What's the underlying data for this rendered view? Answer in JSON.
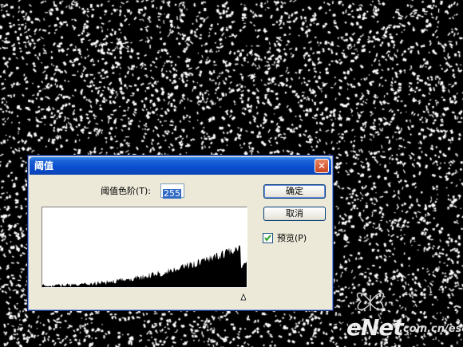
{
  "dialog": {
    "title": "阈值",
    "close_glyph": "✕",
    "level_label": "阈值色阶(T):",
    "level_value": "255",
    "ok_label": "确定",
    "cancel_label": "取消",
    "preview_label": "预览(P)",
    "preview_checked": true
  },
  "watermark": {
    "logo": "eNet",
    "url": ".com.cn/eschool"
  },
  "colors": {
    "titlebar": "#0a4fd0",
    "dialog_bg": "#ece9d8",
    "noise_bg": "#000000",
    "noise_fg": "#ffffff"
  },
  "icons": [
    "close-icon",
    "check-icon",
    "slider-triangle-icon",
    "butterfly-icon"
  ]
}
